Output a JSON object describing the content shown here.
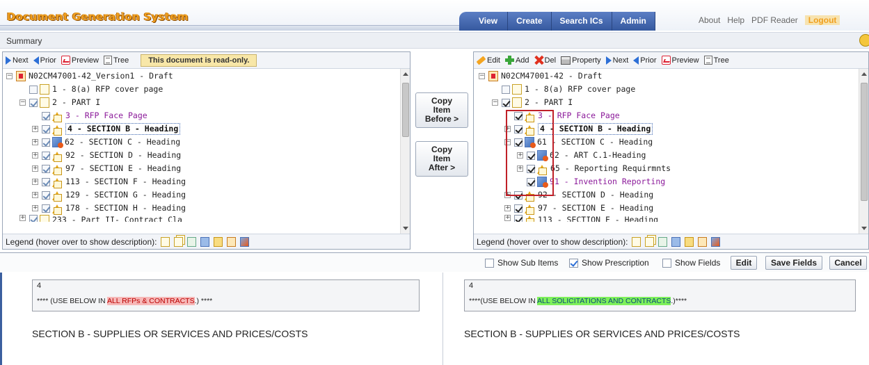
{
  "app_title": "Document Generation System",
  "nav": {
    "tabs": [
      "View",
      "Create",
      "Search ICs",
      "Admin"
    ],
    "links": [
      "About",
      "Help",
      "PDF Reader",
      "Logout"
    ]
  },
  "summary_label": "Summary",
  "left_panel": {
    "toolbar": {
      "next": "Next",
      "prior": "Prior",
      "preview": "Preview",
      "tree": "Tree"
    },
    "readonly_notice": "This document is read-only.",
    "rows": [
      "N02CM47001-42_Version1 - Draft",
      "1 - 8(a) RFP cover page",
      "2 - PART I",
      "3 - RFP Face Page",
      "4 - SECTION B - Heading",
      "62 - SECTION C - Heading",
      "92 - SECTION D - Heading",
      "97 - SECTION E - Heading",
      "113 - SECTION F - Heading",
      "129 - SECTION G - Heading",
      "178 - SECTION H - Heading",
      "233 - Part II- Contract Cla"
    ],
    "legend_label": "Legend (hover over to show description):"
  },
  "copy_buttons": {
    "before": [
      "Copy",
      "Item",
      "Before >"
    ],
    "after": [
      "Copy",
      "Item",
      "After >"
    ]
  },
  "right_panel": {
    "toolbar": {
      "edit": "Edit",
      "add": "Add",
      "del": "Del",
      "property": "Property",
      "next": "Next",
      "prior": "Prior",
      "preview": "Preview",
      "tree": "Tree"
    },
    "rows": [
      "N02CM47001-42 - Draft",
      "1 - 8(a) RFP cover page",
      "2 - PART I",
      "3 - RFP Face Page",
      "4 - SECTION B - Heading",
      "61 - SECTION C - Heading",
      "62 - ART C.1-Heading",
      "65 - Reporting Requirmnts",
      "91 - Invention Reporting",
      "92 - SECTION D - Heading",
      "97 - SECTION E - Heading",
      "113 - SECTION F - Heading"
    ],
    "legend_label": "Legend (hover over to show description):"
  },
  "options": {
    "show_sub_items": "Show Sub Items",
    "show_prescription": "Show Prescription",
    "show_fields": "Show Fields",
    "edit": "Edit",
    "save_fields": "Save Fields",
    "cancel": "Cancel"
  },
  "left_content": {
    "number": "4",
    "prefix": "**** (USE BELOW IN ",
    "highlight": "ALL RFPs & CONTRACTS",
    "suffix": ".) ****",
    "section_title": "SECTION B - SUPPLIES OR SERVICES AND PRICES/COSTS"
  },
  "right_content": {
    "number": "4",
    "prefix": "****(USE BELOW IN ",
    "highlight": "ALL SOLICITATIONS AND CONTRACTS",
    "suffix": ".)****",
    "section_title": "SECTION B - SUPPLIES OR SERVICES AND PRICES/COSTS"
  }
}
